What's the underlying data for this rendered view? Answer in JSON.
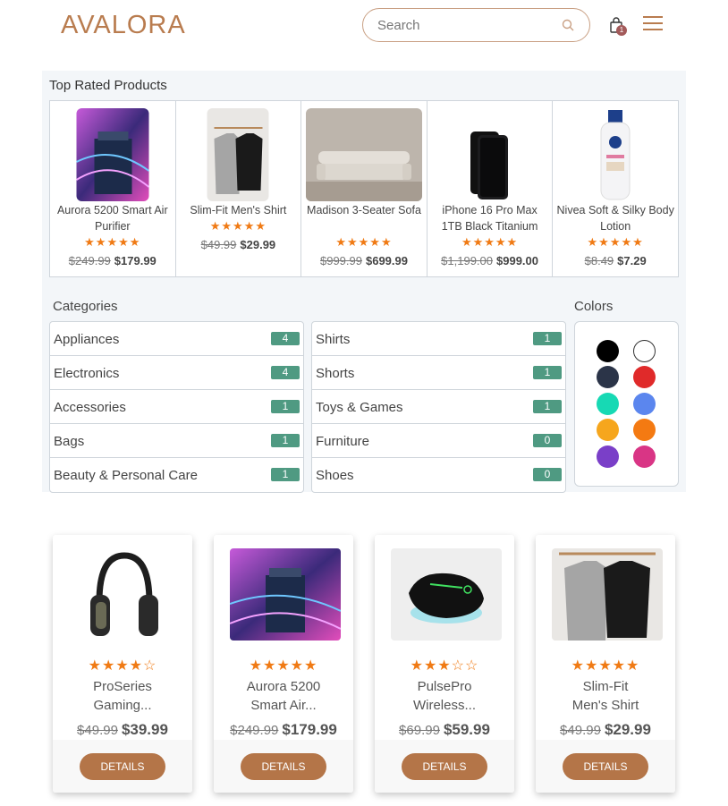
{
  "header": {
    "logo": "AVALORA",
    "search_placeholder": "Search",
    "cart_count": "1"
  },
  "top_rated": {
    "title": "Top Rated Products",
    "items": [
      {
        "name": "Aurora 5200 Smart Air Purifier",
        "old_price": "$249.99",
        "price": "$179.99",
        "rating": 5
      },
      {
        "name": "Slim-Fit Men's Shirt",
        "old_price": "$49.99",
        "price": "$29.99",
        "rating": 5
      },
      {
        "name": "Madison 3-Seater Sofa",
        "old_price": "$999.99",
        "price": "$699.99",
        "rating": 5
      },
      {
        "name": "iPhone 16 Pro Max 1TB Black Titanium",
        "old_price": "$1,199.00",
        "price": "$999.00",
        "rating": 5
      },
      {
        "name": "Nivea Soft & Silky Body Lotion",
        "old_price": "$8.49",
        "price": "$7.29",
        "rating": 5
      }
    ]
  },
  "categories": {
    "title": "Categories",
    "left": [
      {
        "label": "Appliances",
        "count": "4"
      },
      {
        "label": "Electronics",
        "count": "4"
      },
      {
        "label": "Accessories",
        "count": "1"
      },
      {
        "label": "Bags",
        "count": "1"
      },
      {
        "label": "Beauty & Personal Care",
        "count": "1"
      }
    ],
    "right": [
      {
        "label": "Shirts",
        "count": "1"
      },
      {
        "label": "Shorts",
        "count": "1"
      },
      {
        "label": "Toys & Games",
        "count": "1"
      },
      {
        "label": "Furniture",
        "count": "0"
      },
      {
        "label": "Shoes",
        "count": "0"
      }
    ]
  },
  "colors": {
    "title": "Colors",
    "swatches": [
      "#000000",
      "#ffffff",
      "#2b3448",
      "#e02a2a",
      "#17d9b4",
      "#5b86ee",
      "#f6a61d",
      "#f47a12",
      "#7a3fc8",
      "#d93585"
    ]
  },
  "products": [
    {
      "name_line1": "ProSeries",
      "name_line2": "Gaming...",
      "old_price": "$49.99",
      "price": "$39.99",
      "rating": 4,
      "button": "DETAILS"
    },
    {
      "name_line1": "Aurora 5200",
      "name_line2": "Smart Air...",
      "old_price": "$249.99",
      "price": "$179.99",
      "rating": 5,
      "button": "DETAILS"
    },
    {
      "name_line1": "PulsePro",
      "name_line2": "Wireless...",
      "old_price": "$69.99",
      "price": "$59.99",
      "rating": 3,
      "button": "DETAILS"
    },
    {
      "name_line1": "Slim-Fit",
      "name_line2": "Men's Shirt",
      "old_price": "$49.99",
      "price": "$29.99",
      "rating": 5,
      "button": "DETAILS"
    }
  ]
}
